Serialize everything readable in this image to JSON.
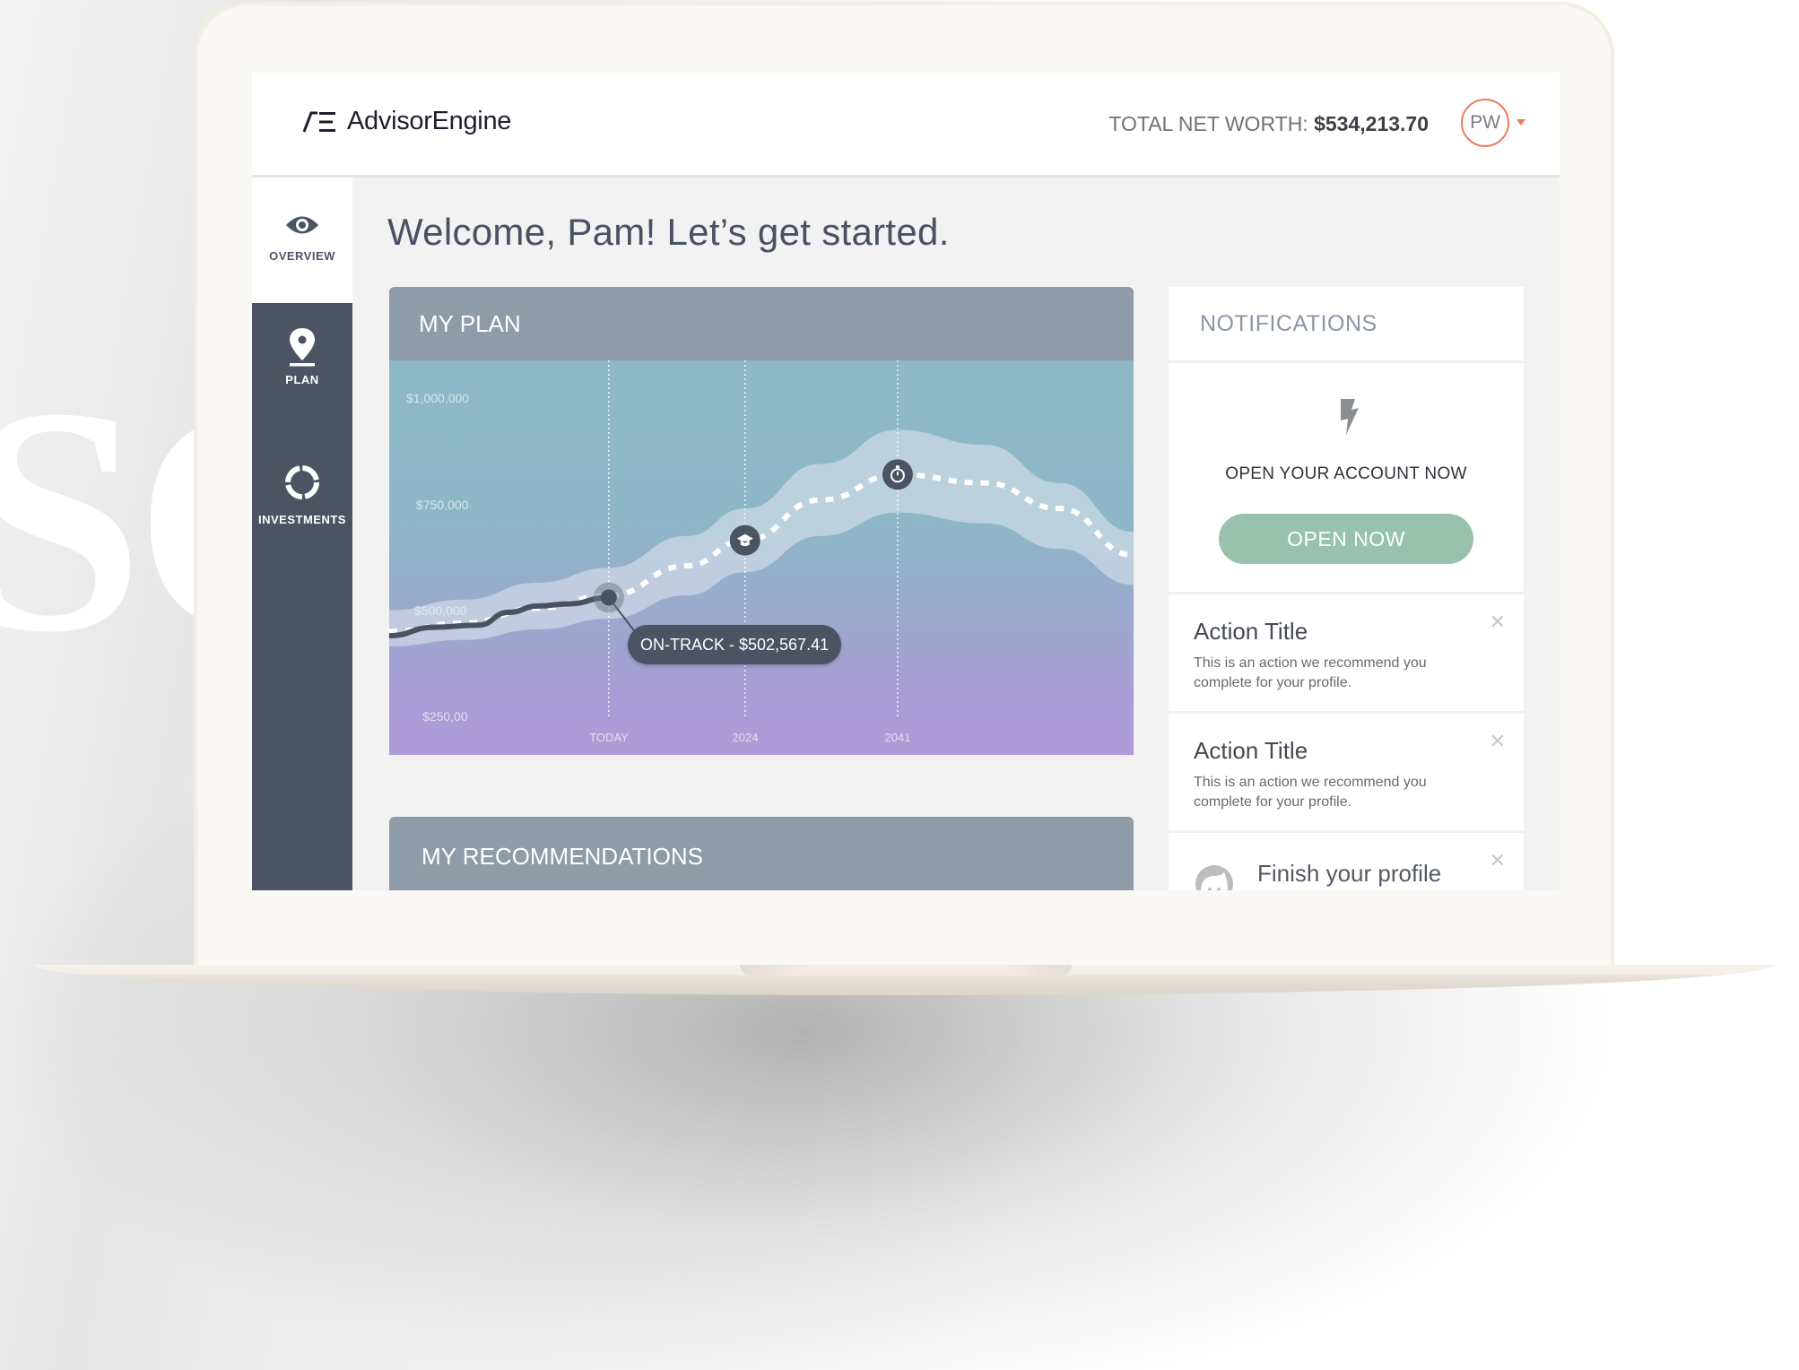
{
  "background": {
    "watermark": "SO"
  },
  "app": {
    "logo_text": "AdvisorEngine",
    "net_worth_label": "TOTAL NET WORTH:",
    "net_worth_value": "$534,213.70",
    "avatar_initials": "PW",
    "accent_color": "#ef7b5a"
  },
  "sidebar": {
    "items": [
      {
        "label": "OVERVIEW",
        "icon": "eye-icon",
        "active": true
      },
      {
        "label": "PLAN",
        "icon": "map-pin-icon",
        "active": false
      },
      {
        "label": "INVESTMENTS",
        "icon": "donut-chart-icon",
        "active": false
      }
    ]
  },
  "main": {
    "welcome": "Welcome, Pam! Let’s get started.",
    "plan_title": "MY PLAN",
    "recommendations_title": "MY RECOMMENDATIONS",
    "tooltip": "ON-TRACK - $502,567.41"
  },
  "chart_data": {
    "type": "area",
    "title": "MY PLAN",
    "y_ticks": [
      "$1,000,000",
      "$750,000",
      "$500,000",
      "$250,00"
    ],
    "y_tick_values": [
      1000000,
      750000,
      500000,
      250000
    ],
    "ylim": [
      200000,
      1100000
    ],
    "x_ticks": [
      "TODAY",
      "2024",
      "2041"
    ],
    "x_tick_positions": [
      0.295,
      0.478,
      0.683
    ],
    "series": [
      {
        "name": "historical",
        "style": "solid",
        "x": [
          0.0,
          0.06,
          0.12,
          0.16,
          0.2,
          0.24,
          0.295
        ],
        "y": [
          440000,
          460000,
          465000,
          495000,
          510000,
          515000,
          530000
        ]
      },
      {
        "name": "projection",
        "style": "dashed",
        "x": [
          0.0,
          0.1,
          0.2,
          0.295,
          0.4,
          0.478,
          0.58,
          0.683,
          0.8,
          0.9,
          1.0
        ],
        "y": [
          450000,
          470000,
          505000,
          535000,
          605000,
          665000,
          760000,
          820000,
          800000,
          740000,
          630000
        ]
      },
      {
        "name": "range-upper",
        "x": [
          0.0,
          0.1,
          0.2,
          0.295,
          0.4,
          0.478,
          0.58,
          0.683,
          0.8,
          0.9,
          1.0
        ],
        "y": [
          500000,
          525000,
          565000,
          600000,
          675000,
          740000,
          845000,
          925000,
          890000,
          800000,
          685000
        ]
      },
      {
        "name": "range-lower",
        "x": [
          0.0,
          0.1,
          0.2,
          0.295,
          0.4,
          0.478,
          0.58,
          0.683,
          0.8,
          0.9,
          1.0
        ],
        "y": [
          415000,
          430000,
          455000,
          480000,
          535000,
          590000,
          675000,
          730000,
          705000,
          645000,
          560000
        ]
      }
    ],
    "markers": [
      {
        "name": "today",
        "x": 0.295,
        "y": 530000,
        "icon": "current-point"
      },
      {
        "name": "education",
        "x": 0.478,
        "y": 665000,
        "icon": "graduation-cap-icon"
      },
      {
        "name": "retirement",
        "x": 0.683,
        "y": 820000,
        "icon": "stopwatch-icon"
      }
    ],
    "annotation": "ON-TRACK - $502,567.41"
  },
  "notifications": {
    "title": "NOTIFICATIONS",
    "promo_text": "OPEN YOUR ACCOUNT NOW",
    "promo_button": "OPEN NOW",
    "button_color": "#98c2ae",
    "actions": [
      {
        "title": "Action Title",
        "description": "This is an action we recommend you complete for your profile."
      },
      {
        "title": "Action Title",
        "description": "This is an action we recommend you complete for your profile."
      }
    ],
    "profile_item": "Finish your profile"
  }
}
